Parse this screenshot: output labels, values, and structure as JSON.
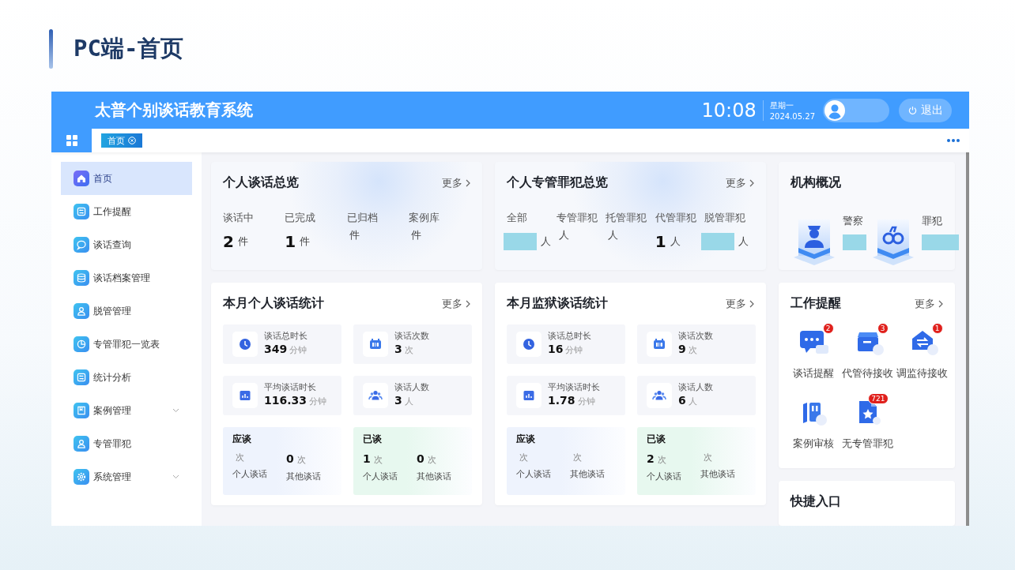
{
  "slide_title": "PC端-首页",
  "app": {
    "title": "太普个别谈话教育系统",
    "time": "10:08",
    "weekday": "星期一",
    "date": "2024.05.27",
    "logout": "退出"
  },
  "tabs": [
    {
      "label": "首页",
      "selected": true
    }
  ],
  "sidebar": [
    {
      "label": "首页",
      "kind": "home",
      "selected": true,
      "has_submenu": false
    },
    {
      "label": "工作提醒",
      "kind": "panel",
      "selected": false,
      "has_submenu": false
    },
    {
      "label": "谈话查询",
      "kind": "chat",
      "selected": false,
      "has_submenu": false
    },
    {
      "label": "谈话档案管理",
      "kind": "database",
      "selected": false,
      "has_submenu": false
    },
    {
      "label": "脱管管理",
      "kind": "person",
      "selected": false,
      "has_submenu": false
    },
    {
      "label": "专管罪犯一览表",
      "kind": "pie",
      "selected": false,
      "has_submenu": false
    },
    {
      "label": "统计分析",
      "kind": "panel",
      "selected": false,
      "has_submenu": false
    },
    {
      "label": "案例管理",
      "kind": "book",
      "selected": false,
      "has_submenu": true
    },
    {
      "label": "专管罪犯",
      "kind": "person",
      "selected": false,
      "has_submenu": false
    },
    {
      "label": "系统管理",
      "kind": "gear",
      "selected": false,
      "has_submenu": true
    }
  ],
  "overview": [
    {
      "title": "个人谈话总览",
      "more": "更多",
      "stats": [
        {
          "label": "谈话中",
          "kind": "number",
          "value": "2",
          "unit": "件"
        },
        {
          "label": "已完成",
          "kind": "number",
          "value": "1",
          "unit": "件"
        },
        {
          "label": "已归档",
          "kind": "empty",
          "unit": "件"
        },
        {
          "label": "案例库",
          "kind": "empty",
          "unit": "件"
        }
      ]
    },
    {
      "title": "个人专管罪犯总览",
      "more": "更多",
      "stats": [
        {
          "label": "全部",
          "kind": "redacted",
          "unit": "人"
        },
        {
          "label": "专管罪犯",
          "kind": "empty",
          "unit": "人"
        },
        {
          "label": "托管罪犯",
          "kind": "empty",
          "unit": "人"
        },
        {
          "label": "代管罪犯",
          "kind": "number",
          "value": "1",
          "unit": "人"
        },
        {
          "label": "脱管罪犯",
          "kind": "redacted",
          "unit": "人"
        }
      ]
    }
  ],
  "org": {
    "title": "机构概况",
    "items": [
      {
        "kind": "police",
        "label": "警察",
        "redacted": true
      },
      {
        "kind": "handcuffs",
        "label": "罪犯",
        "redacted": true
      }
    ]
  },
  "monthly": [
    {
      "title": "本月个人谈话统计",
      "more": "更多",
      "metrics": [
        {
          "kind": "clock",
          "label": "谈话总时长",
          "value": "349",
          "unit": "分钟"
        },
        {
          "kind": "calendar",
          "label": "谈话次数",
          "value": "3",
          "unit": "次"
        },
        {
          "kind": "chart",
          "label": "平均谈话时长",
          "value": "116.33",
          "unit": "分钟"
        },
        {
          "kind": "people",
          "label": "谈话人数",
          "value": "3",
          "unit": "人"
        }
      ],
      "summary": [
        {
          "title": "应谈",
          "color": "#eef3fd",
          "entries": [
            {
              "unit": "次",
              "label": "个人谈话"
            },
            {
              "value": "0",
              "unit": "次",
              "label": "其他谈话"
            }
          ]
        },
        {
          "title": "已谈",
          "color": "#e7f8ef",
          "entries": [
            {
              "value": "1",
              "unit": "次",
              "label": "个人谈话"
            },
            {
              "value": "0",
              "unit": "次",
              "label": "其他谈话"
            }
          ]
        }
      ]
    },
    {
      "title": "本月监狱谈话统计",
      "more": "更多",
      "metrics": [
        {
          "kind": "clock",
          "label": "谈话总时长",
          "value": "16",
          "unit": "分钟"
        },
        {
          "kind": "calendar",
          "label": "谈话次数",
          "value": "9",
          "unit": "次"
        },
        {
          "kind": "chart",
          "label": "平均谈话时长",
          "value": "1.78",
          "unit": "分钟"
        },
        {
          "kind": "people",
          "label": "谈话人数",
          "value": "6",
          "unit": "人"
        }
      ],
      "summary": [
        {
          "title": "应谈",
          "color": "#eef3fd",
          "entries": [
            {
              "unit": "次",
              "label": "个人谈话"
            },
            {
              "unit": "次",
              "label": "其他谈话"
            }
          ]
        },
        {
          "title": "已谈",
          "color": "#e7f8ef",
          "entries": [
            {
              "value": "2",
              "unit": "次",
              "label": "个人谈话"
            },
            {
              "unit": "次",
              "label": "其他谈话"
            }
          ]
        }
      ]
    }
  ],
  "reminders": {
    "title": "工作提醒",
    "more": "更多",
    "items": [
      {
        "kind": "chat",
        "label": "谈话提醒",
        "badge": "2"
      },
      {
        "kind": "cabinet",
        "label": "代管待接收",
        "badge": "3"
      },
      {
        "kind": "transfer",
        "label": "调监待接收",
        "badge": "1"
      },
      {
        "kind": "books",
        "label": "案例审核"
      },
      {
        "kind": "document",
        "label": "无专管罪犯",
        "badge": "721"
      }
    ]
  },
  "quick": {
    "title": "快捷入口"
  }
}
